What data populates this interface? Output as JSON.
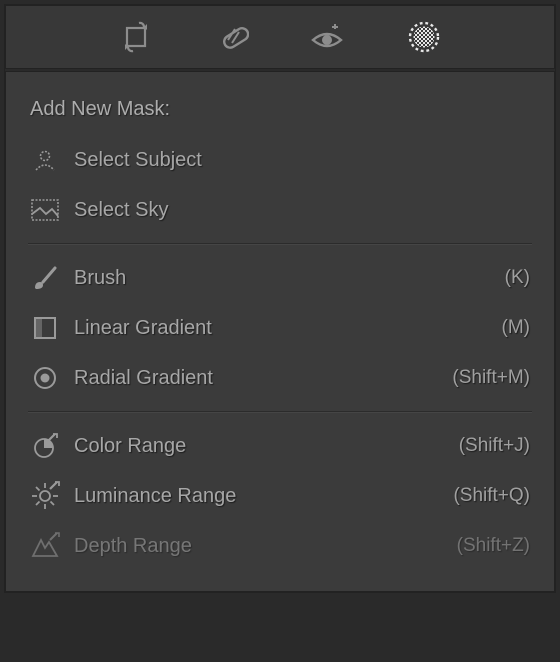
{
  "toolbar": {
    "tools": [
      {
        "name": "crop-icon"
      },
      {
        "name": "spot-removal-icon"
      },
      {
        "name": "red-eye-icon"
      },
      {
        "name": "masking-icon",
        "active": true
      }
    ]
  },
  "panel": {
    "heading": "Add New Mask:",
    "groups": [
      [
        {
          "icon": "select-subject-icon",
          "label": "Select Subject",
          "shortcut": "",
          "disabled": false
        },
        {
          "icon": "select-sky-icon",
          "label": "Select Sky",
          "shortcut": "",
          "disabled": false
        }
      ],
      [
        {
          "icon": "brush-icon",
          "label": "Brush",
          "shortcut": "(K)",
          "disabled": false
        },
        {
          "icon": "linear-gradient-icon",
          "label": "Linear Gradient",
          "shortcut": "(M)",
          "disabled": false
        },
        {
          "icon": "radial-gradient-icon",
          "label": "Radial Gradient",
          "shortcut": "(Shift+M)",
          "disabled": false
        }
      ],
      [
        {
          "icon": "color-range-icon",
          "label": "Color Range",
          "shortcut": "(Shift+J)",
          "disabled": false
        },
        {
          "icon": "luminance-range-icon",
          "label": "Luminance Range",
          "shortcut": "(Shift+Q)",
          "disabled": false
        },
        {
          "icon": "depth-range-icon",
          "label": "Depth Range",
          "shortcut": "(Shift+Z)",
          "disabled": true
        }
      ]
    ]
  }
}
